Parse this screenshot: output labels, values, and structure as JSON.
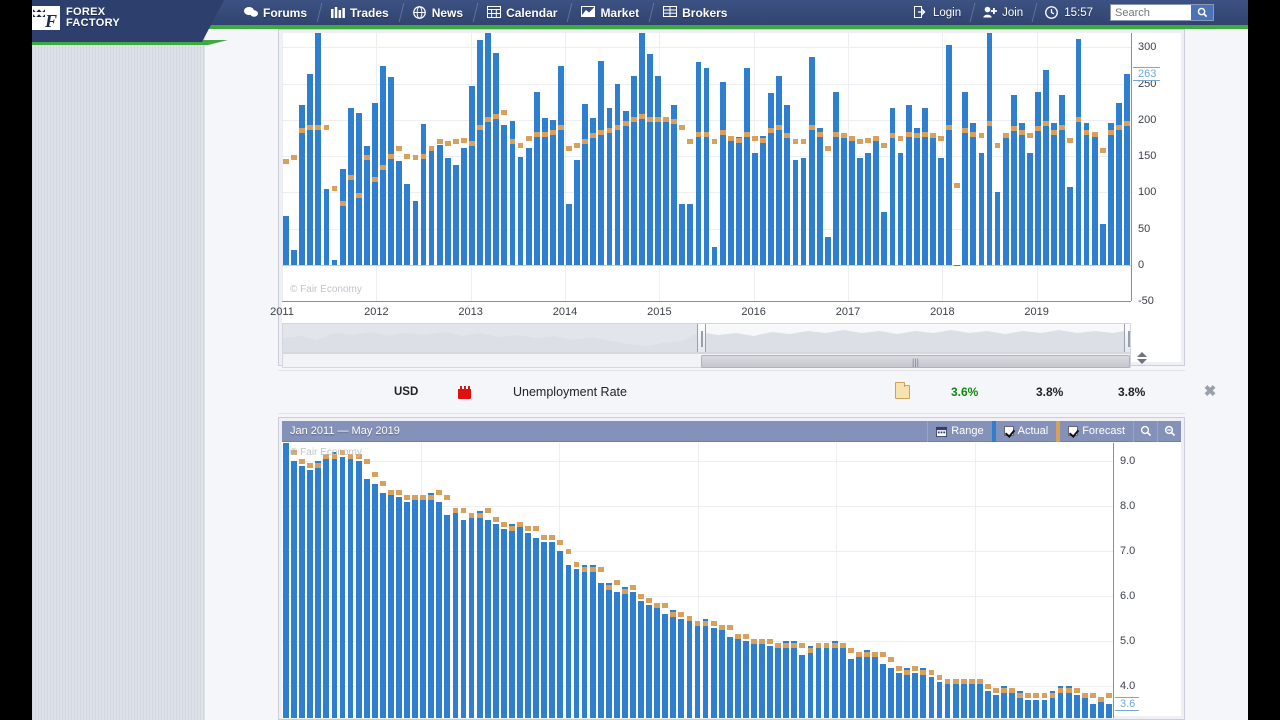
{
  "site": {
    "logo_line1": "FOREX",
    "logo_line2": "FACTORY",
    "logo_icon": "checkered-flag-icon"
  },
  "nav": {
    "items": [
      {
        "label": "Forums",
        "icon": "speech-bubbles-icon"
      },
      {
        "label": "Trades",
        "icon": "bar-chart-icon"
      },
      {
        "label": "News",
        "icon": "globe-icon"
      },
      {
        "label": "Calendar",
        "icon": "calendar-grid-icon"
      },
      {
        "label": "Market",
        "icon": "mountain-chart-icon"
      },
      {
        "label": "Brokers",
        "icon": "table-icon"
      }
    ],
    "right": [
      {
        "label": "Login",
        "icon": "login-arrow-icon"
      },
      {
        "label": "Join",
        "icon": "user-plus-icon"
      },
      {
        "label": "15:57",
        "icon": "clock-icon"
      }
    ],
    "search": {
      "placeholder": "Search",
      "value": "",
      "button_icon": "magnifier-icon"
    }
  },
  "event": {
    "currency": "USD",
    "impact_icon": "red-folder-impact-icon",
    "title": "Unemployment Rate",
    "detail_icon": "folder-detail-icon",
    "actual": "3.6%",
    "forecast": "3.8%",
    "previous": "3.8%",
    "actual_color": "#118811",
    "close_icon": "close-icon"
  },
  "top_chart": {
    "watermark": "© Fair Economy",
    "highlight_label": "263",
    "navigator": {
      "left_handle_icon": "range-handle-icon",
      "right_handle_icon": "range-handle-icon",
      "scroll_grip_icon": "scroll-grip-icon",
      "spinner_up_icon": "triangle-up-icon",
      "spinner_down_icon": "triangle-down-icon"
    }
  },
  "bottom_chart": {
    "title": "Jan 2011 — May 2019",
    "watermark": "© Fair Economy",
    "highlight_label": "3.6",
    "controls": {
      "range_label": "Range",
      "range_icon": "calendar-icon",
      "actual_label": "Actual",
      "actual_checked": true,
      "actual_color": "#2f7fd0",
      "forecast_label": "Forecast",
      "forecast_checked": true,
      "forecast_color": "#d9a05b",
      "zoom_in_icon": "magnifier-plus-icon",
      "zoom_out_icon": "magnifier-minus-icon"
    }
  },
  "chart_data": [
    {
      "id": "nonfarm-payrolls",
      "type": "bar",
      "title": "",
      "xlabel": "",
      "ylabel": "",
      "ylim": [
        -50,
        320
      ],
      "yticks": [
        300,
        250,
        200,
        150,
        100,
        50,
        0,
        -50
      ],
      "xticks": [
        "2011",
        "2012",
        "2013",
        "2014",
        "2015",
        "2016",
        "2017",
        "2018",
        "2019"
      ],
      "grid": true,
      "legend": [
        "Actual",
        "Forecast"
      ],
      "series": [
        {
          "name": "Actual",
          "color": "#2f7fd0",
          "values": [
            68,
            20,
            221,
            263,
            321,
            104,
            7,
            132,
            216,
            210,
            164,
            223,
            275,
            259,
            143,
            112,
            88,
            195,
            161,
            165,
            148,
            138,
            161,
            247,
            311,
            332,
            293,
            193,
            199,
            149,
            161,
            238,
            203,
            200,
            274,
            84,
            144,
            222,
            203,
            282,
            217,
            250,
            213,
            260,
            423,
            291,
            260,
            201,
            221,
            84,
            84,
            280,
            271,
            24,
            252,
            178,
            176,
            271,
            155,
            178,
            237,
            261,
            220,
            144,
            148,
            287,
            189,
            38,
            239,
            175,
            176,
            148,
            155,
            175,
            73,
            216,
            155,
            221,
            189,
            216,
            175,
            148,
            304,
            -1,
            239,
            196,
            155,
            324,
            100,
            176,
            234,
            196,
            155,
            239,
            269,
            196,
            234,
            108,
            312,
            196,
            176,
            56,
            196,
            224,
            263
          ]
        },
        {
          "name": "Forecast",
          "color": "#d9a05b",
          "values": [
            142,
            148,
            185,
            190,
            190,
            190,
            105,
            85,
            120,
            95,
            148,
            118,
            135,
            150,
            160,
            150,
            148,
            150,
            160,
            170,
            168,
            170,
            172,
            168,
            190,
            200,
            205,
            210,
            170,
            165,
            175,
            180,
            180,
            182,
            190,
            160,
            165,
            170,
            178,
            182,
            185,
            190,
            195,
            200,
            205,
            200,
            200,
            200,
            198,
            190,
            170,
            180,
            180,
            170,
            182,
            175,
            172,
            180,
            175,
            172,
            185,
            190,
            178,
            170,
            170,
            190,
            180,
            160,
            180,
            178,
            175,
            170,
            172,
            175,
            165,
            178,
            175,
            180,
            178,
            180,
            178,
            175,
            190,
            110,
            185,
            180,
            178,
            195,
            165,
            178,
            188,
            182,
            178,
            188,
            195,
            182,
            190,
            172,
            200,
            182,
            180,
            158,
            182,
            190,
            195
          ]
        }
      ]
    },
    {
      "id": "unemployment-rate",
      "type": "bar",
      "title": "Jan 2011 — May 2019",
      "xlabel": "",
      "ylabel": "",
      "ylim": [
        3.3,
        9.4
      ],
      "yticks": [
        9.0,
        8.0,
        7.0,
        6.0,
        5.0,
        4.0
      ],
      "grid": true,
      "legend": [
        "Actual",
        "Forecast"
      ],
      "series": [
        {
          "name": "Actual",
          "color": "#2f7fd0",
          "values": [
            9.4,
            9.0,
            8.9,
            8.8,
            9.0,
            9.1,
            9.2,
            9.1,
            9.1,
            9.0,
            8.6,
            8.5,
            8.3,
            8.3,
            8.2,
            8.1,
            8.2,
            8.2,
            8.3,
            8.1,
            7.8,
            7.9,
            7.7,
            7.8,
            7.9,
            7.7,
            7.6,
            7.5,
            7.6,
            7.6,
            7.4,
            7.3,
            7.2,
            7.2,
            7.0,
            6.7,
            6.6,
            6.7,
            6.7,
            6.3,
            6.3,
            6.1,
            6.2,
            6.1,
            5.9,
            5.8,
            5.8,
            5.6,
            5.7,
            5.5,
            5.5,
            5.4,
            5.5,
            5.3,
            5.3,
            5.1,
            5.1,
            5.0,
            5.0,
            5.0,
            4.9,
            4.9,
            5.0,
            5.0,
            4.7,
            4.9,
            4.9,
            4.9,
            5.0,
            4.9,
            4.6,
            4.7,
            4.8,
            4.7,
            4.5,
            4.4,
            4.3,
            4.4,
            4.3,
            4.4,
            4.2,
            4.1,
            4.1,
            4.1,
            4.1,
            4.1,
            4.1,
            3.9,
            3.8,
            4.0,
            3.9,
            3.9,
            3.7,
            3.7,
            3.7,
            3.9,
            4.0,
            4.0,
            3.8,
            3.8,
            3.6,
            3.7,
            3.6
          ]
        },
        {
          "name": "Forecast",
          "color": "#d9a05b",
          "values": [
            9.6,
            9.2,
            9.0,
            8.9,
            8.9,
            9.1,
            9.1,
            9.2,
            9.1,
            9.1,
            9.0,
            8.7,
            8.5,
            8.3,
            8.3,
            8.2,
            8.2,
            8.2,
            8.2,
            8.3,
            8.2,
            7.9,
            7.9,
            7.8,
            7.8,
            7.9,
            7.7,
            7.6,
            7.5,
            7.6,
            7.5,
            7.5,
            7.3,
            7.3,
            7.2,
            7.0,
            6.7,
            6.6,
            6.6,
            6.6,
            6.2,
            6.3,
            6.1,
            6.2,
            6.0,
            5.9,
            5.8,
            5.8,
            5.6,
            5.6,
            5.5,
            5.4,
            5.4,
            5.4,
            5.3,
            5.3,
            5.1,
            5.1,
            5.0,
            5.0,
            5.0,
            4.9,
            4.9,
            4.9,
            4.9,
            4.8,
            4.9,
            4.9,
            4.9,
            4.9,
            4.8,
            4.7,
            4.7,
            4.7,
            4.7,
            4.6,
            4.4,
            4.3,
            4.4,
            4.3,
            4.3,
            4.2,
            4.1,
            4.1,
            4.1,
            4.1,
            4.1,
            4.0,
            3.9,
            3.9,
            3.9,
            3.8,
            3.8,
            3.8,
            3.8,
            3.8,
            3.9,
            3.9,
            3.9,
            3.8,
            3.8,
            3.7,
            3.8
          ]
        }
      ]
    }
  ]
}
